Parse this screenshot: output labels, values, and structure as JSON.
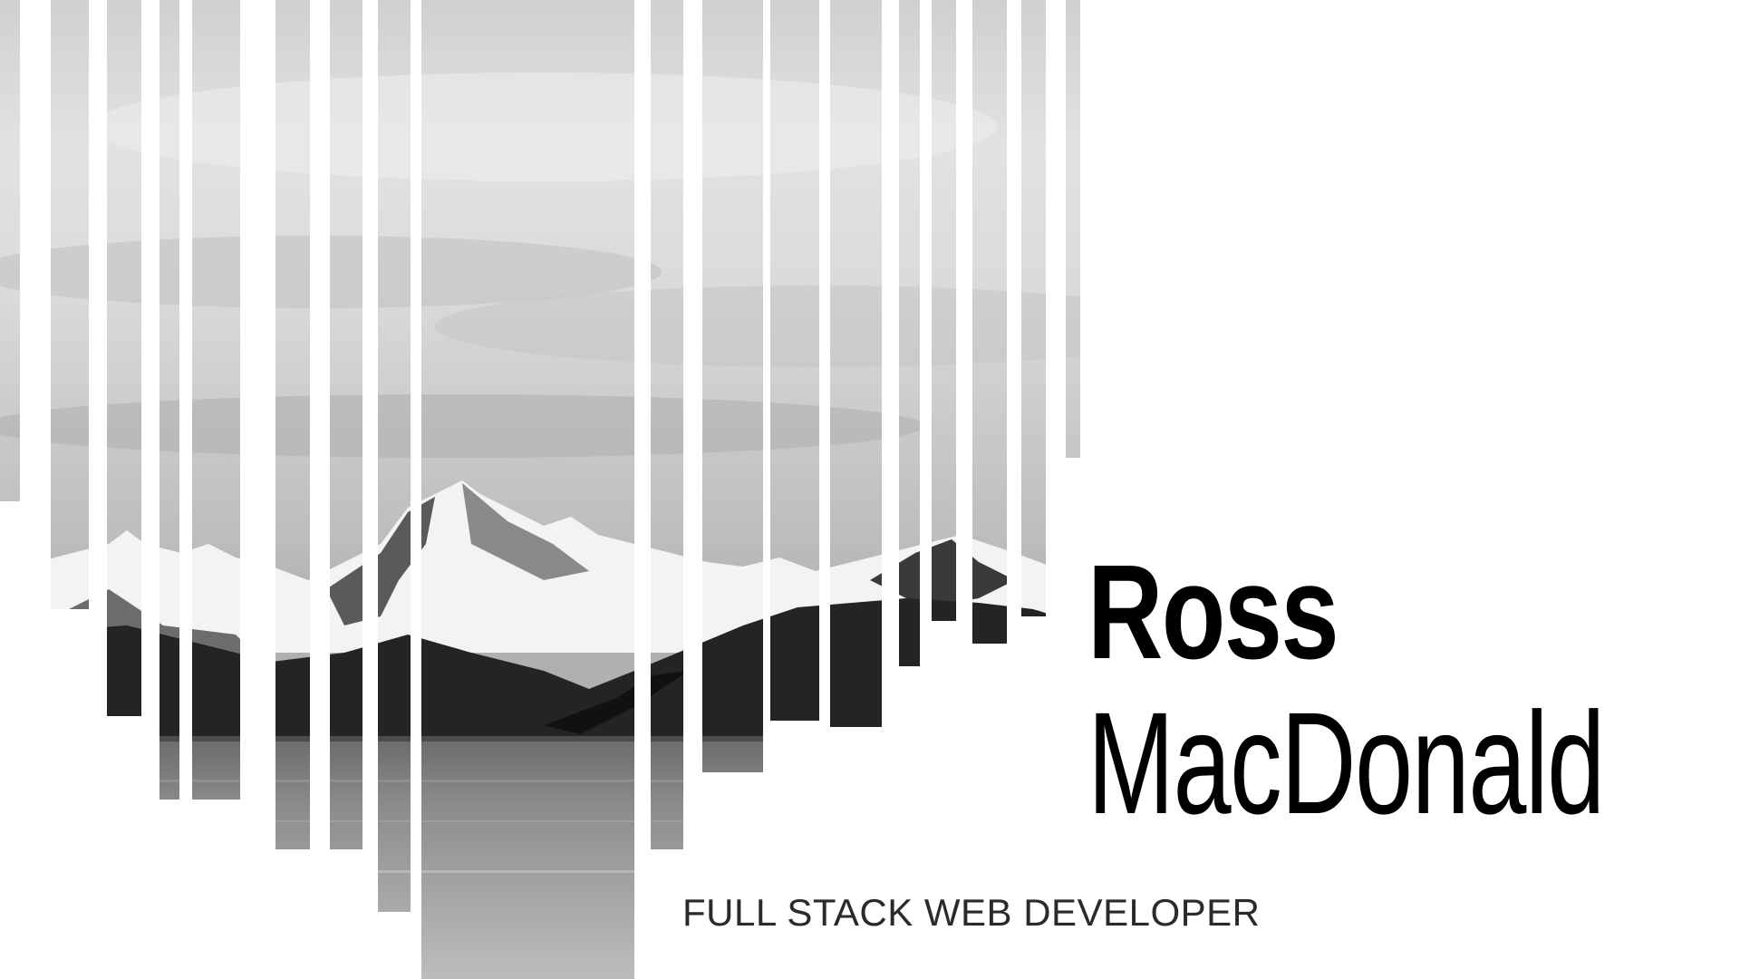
{
  "hero": {
    "name_first": "Ross",
    "name_last": "MacDonald",
    "tagline": "FULL STACK WEB DEVELOPER",
    "photo_icon": "mountain-lake-photo",
    "colors": {
      "background": "#ffffff",
      "text": "#000000",
      "tagline": "#2a2a2a"
    }
  }
}
